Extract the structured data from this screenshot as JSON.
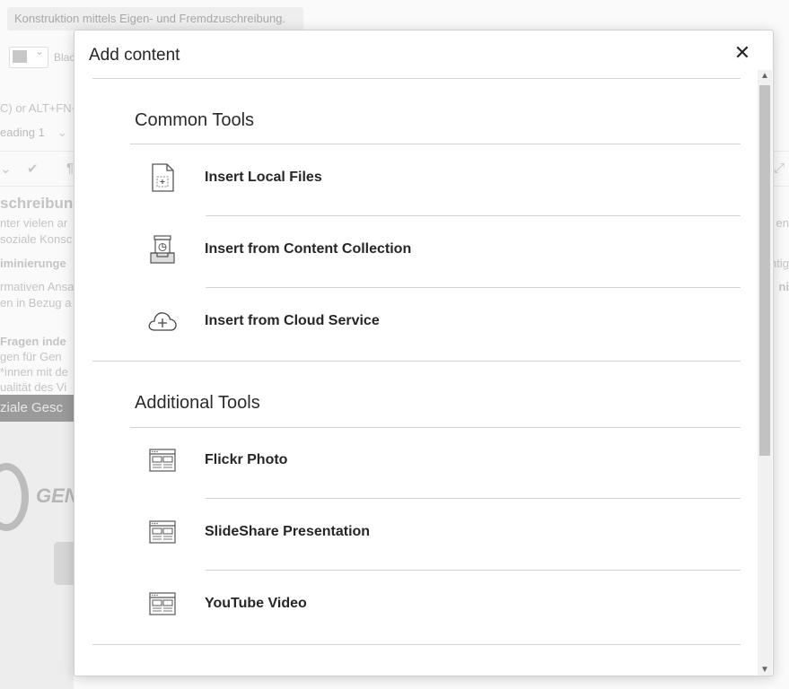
{
  "background": {
    "title_field": "Konstruktion mittels Eigen- und Fremdzuschreibung.",
    "color_label": "Blac",
    "shortcut_hint": "C) or ALT+FN+",
    "heading_select": "eading 1",
    "text_lines": [
      "schreibung",
      "nter vielen ar",
      "soziale Konsc",
      "iminierunge",
      "rmativen Ansa",
      "en in Bezug a",
      "Fragen inde",
      "gen für Gen",
      "*innen mit de",
      "ualität des Vi"
    ],
    "right_fragments": [
      "en",
      "ntig",
      "ni"
    ],
    "image_header": "ziale Gesc",
    "image_text": "GEN"
  },
  "modal": {
    "title": "Add content",
    "close_glyph": "✕",
    "sections": [
      {
        "title": "Common Tools",
        "items": [
          {
            "label": "Insert Local Files",
            "icon": "local-file-icon"
          },
          {
            "label": "Insert from Content Collection",
            "icon": "content-collection-icon"
          },
          {
            "label": "Insert from Cloud Service",
            "icon": "cloud-add-icon"
          }
        ]
      },
      {
        "title": "Additional Tools",
        "items": [
          {
            "label": "Flickr Photo",
            "icon": "mashup-window-icon"
          },
          {
            "label": "SlideShare Presentation",
            "icon": "mashup-window-icon"
          },
          {
            "label": "YouTube Video",
            "icon": "mashup-window-icon"
          }
        ]
      }
    ]
  },
  "colors": {
    "text": "#262626",
    "separator": "#d2d2d2",
    "icon_stroke": "#555555"
  }
}
